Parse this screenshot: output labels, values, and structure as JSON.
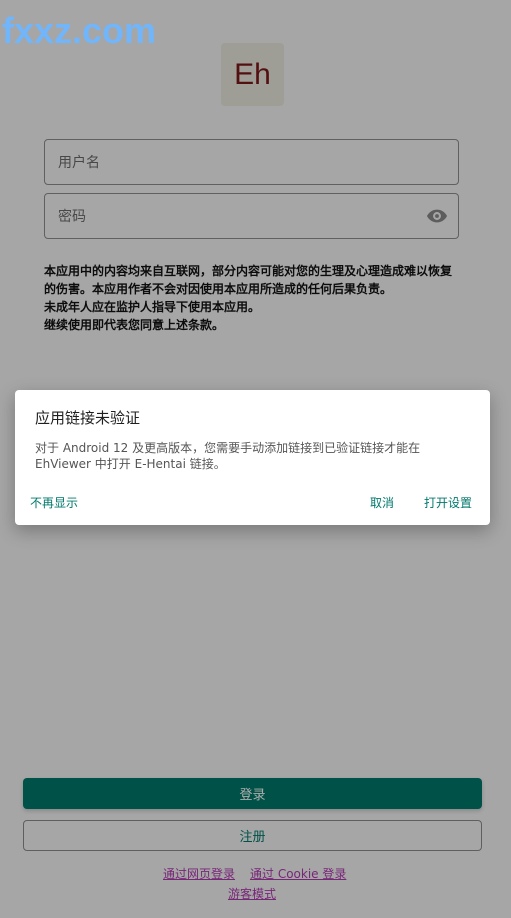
{
  "watermark": "fxxz.com",
  "logo": {
    "text": "Eh"
  },
  "login_form": {
    "username_placeholder": "用户名",
    "password_placeholder": "密码",
    "eye_icon": "eye-icon"
  },
  "notice": {
    "lines": [
      "本应用中的内容均来自互联网，部分内容可能对您的生理及心理造成难以恢复",
      "的伤害。本应用作者不会对因使用本应用所造成的任何后果负责。",
      "未成年人应在监护人指导下使用本应用。",
      "继续使用即代表您同意上述条款。"
    ]
  },
  "dialog": {
    "title": "应用链接未验证",
    "body": "对于 Android 12 及更高版本，您需要手动添加链接到已验证链接才能在 EhViewer 中打开 E-Hentai 链接。",
    "buttons": {
      "dont_show": "不再显示",
      "cancel": "取消",
      "open_settings": "打开设置"
    }
  },
  "actions": {
    "login_label": "登录",
    "register_label": "注册",
    "web_login_label": "通过网页登录",
    "cookie_login_label": "通过 Cookie 登录",
    "guest_label": "游客模式"
  },
  "colors": {
    "accent": "#00796b",
    "link": "#b13ab1",
    "logo_text": "#7a1818",
    "watermark": "#6fb6ff"
  }
}
